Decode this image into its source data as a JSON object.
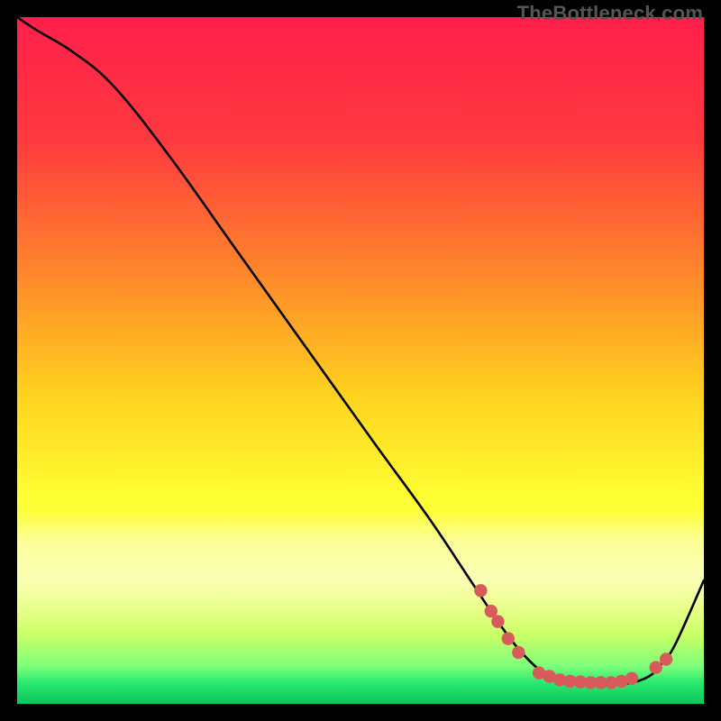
{
  "watermark": "TheBottleneck.com",
  "chart_data": {
    "type": "line",
    "title": "",
    "xlabel": "",
    "ylabel": "",
    "xlim": [
      0,
      100
    ],
    "ylim": [
      0,
      100
    ],
    "gradient_stops": [
      {
        "offset": 0.0,
        "color": "#ff1f4b"
      },
      {
        "offset": 0.18,
        "color": "#ff3a3f"
      },
      {
        "offset": 0.38,
        "color": "#ff8a2a"
      },
      {
        "offset": 0.55,
        "color": "#ffd21f"
      },
      {
        "offset": 0.7,
        "color": "#ffff33"
      },
      {
        "offset": 0.82,
        "color": "#f6ff5a"
      },
      {
        "offset": 0.9,
        "color": "#c8ff66"
      },
      {
        "offset": 0.945,
        "color": "#7eff7a"
      },
      {
        "offset": 0.97,
        "color": "#28e86e"
      },
      {
        "offset": 1.0,
        "color": "#0cc45e"
      }
    ],
    "pale_band": {
      "from_y": 72,
      "to_y": 90
    },
    "series": [
      {
        "name": "curve",
        "x": [
          0,
          3,
          8,
          14,
          22,
          32,
          42,
          52,
          60,
          66,
          70,
          73,
          76,
          78,
          82,
          86,
          89,
          92,
          94,
          96,
          100
        ],
        "y": [
          100,
          98,
          95,
          90,
          80,
          66,
          52,
          38,
          27,
          18,
          12,
          8,
          5,
          4,
          3,
          3,
          3,
          4,
          6,
          9,
          18
        ]
      }
    ],
    "markers": {
      "name": "dots",
      "color": "#d85a5a",
      "points": [
        {
          "x": 67.5,
          "y": 16.5
        },
        {
          "x": 69.0,
          "y": 13.5
        },
        {
          "x": 70.0,
          "y": 12.0
        },
        {
          "x": 71.5,
          "y": 9.5
        },
        {
          "x": 73.0,
          "y": 7.5
        },
        {
          "x": 76.0,
          "y": 4.5
        },
        {
          "x": 77.5,
          "y": 4.0
        },
        {
          "x": 79.0,
          "y": 3.5
        },
        {
          "x": 80.5,
          "y": 3.3
        },
        {
          "x": 82.0,
          "y": 3.2
        },
        {
          "x": 83.5,
          "y": 3.1
        },
        {
          "x": 85.0,
          "y": 3.1
        },
        {
          "x": 86.5,
          "y": 3.1
        },
        {
          "x": 88.0,
          "y": 3.3
        },
        {
          "x": 89.5,
          "y": 3.7
        },
        {
          "x": 93.0,
          "y": 5.3
        },
        {
          "x": 94.5,
          "y": 6.5
        }
      ]
    }
  }
}
